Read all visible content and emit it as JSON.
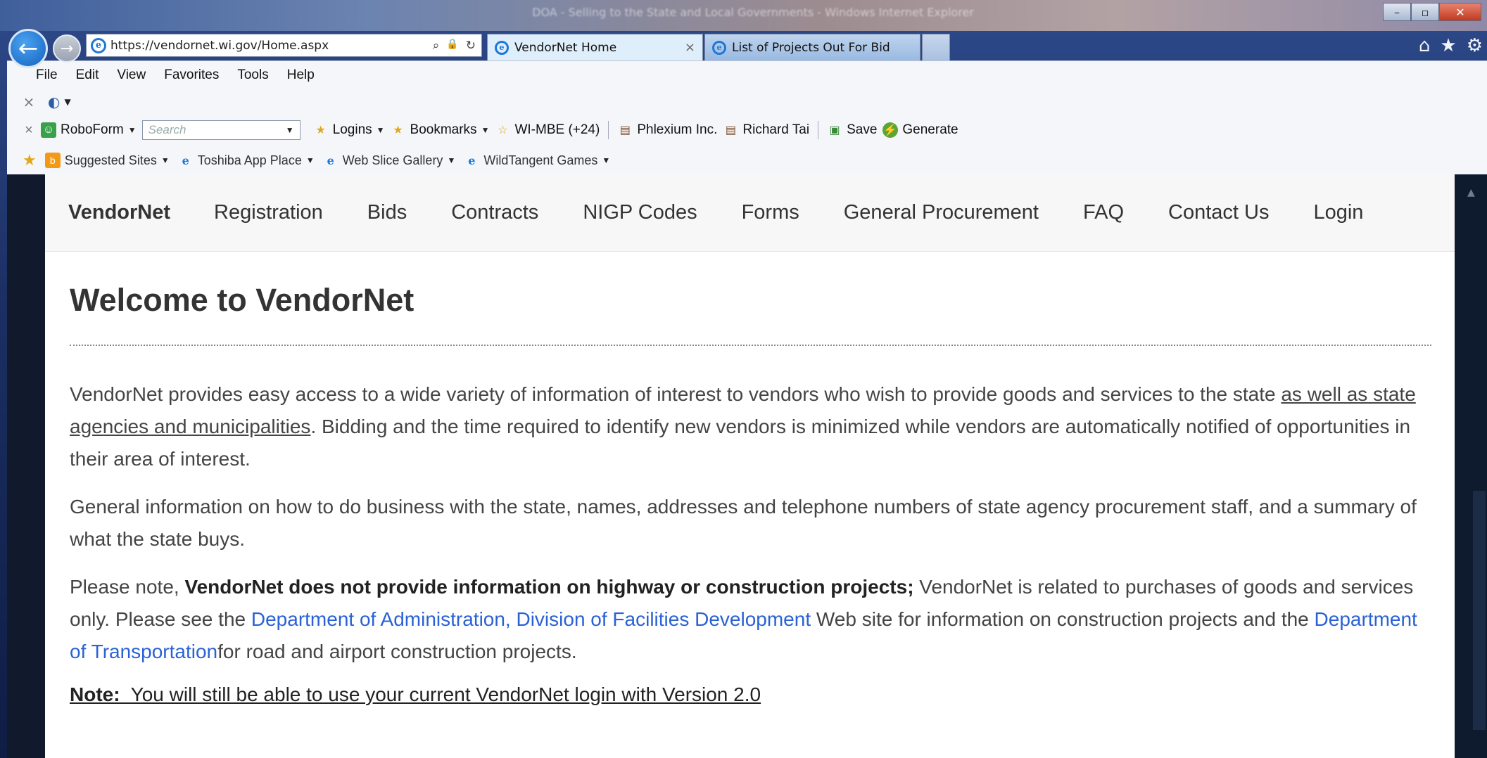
{
  "window": {
    "title": "DOA - Selling to the State and Local Governments - Windows Internet Explorer",
    "controls": {
      "minimize": "–",
      "maximize": "▫",
      "close": "✕"
    }
  },
  "navigation": {
    "back_icon": "←",
    "forward_icon": "→",
    "address": {
      "url": "https://vendornet.wi.gov/Home.aspx",
      "search_icon": "⌕",
      "lock_icon": "🔒",
      "refresh_icon": "↻"
    },
    "tabs": [
      {
        "label": "VendorNet Home",
        "close": "×"
      },
      {
        "label": "List of Projects Out For Bid"
      }
    ],
    "right_icons": {
      "home": "⌂",
      "favorites": "★",
      "tools": "⚙"
    }
  },
  "menubar": [
    "File",
    "Edit",
    "View",
    "Favorites",
    "Tools",
    "Help"
  ],
  "roboform": {
    "label": "RoboForm",
    "search_placeholder": "Search",
    "items": [
      {
        "label": "Logins"
      },
      {
        "label": "Bookmarks"
      },
      {
        "label": "WI-MBE (+24)"
      },
      {
        "label": "Phlexium Inc."
      },
      {
        "label": "Richard Tai"
      },
      {
        "label": "Save"
      },
      {
        "label": "Generate"
      }
    ]
  },
  "favorites_bar": [
    {
      "label": "Suggested Sites"
    },
    {
      "label": "Toshiba App Place"
    },
    {
      "label": "Web Slice Gallery"
    },
    {
      "label": "WildTangent Games"
    }
  ],
  "site": {
    "brand": "VendorNet",
    "nav": [
      "Registration",
      "Bids",
      "Contracts",
      "NIGP Codes",
      "Forms",
      "General Procurement",
      "FAQ",
      "Contact Us",
      "Login"
    ],
    "heading": "Welcome to VendorNet",
    "p1": {
      "a": "VendorNet provides easy access to a wide variety of information of interest to vendors who wish to provide goods and services to the state ",
      "u": "as well as state agencies and municipalities",
      "b": ". Bidding and the time required to identify new vendors is minimized while vendors are automatically notified of opportunities in their area of interest."
    },
    "p2": "General information on how to do business with the state, names, addresses and telephone numbers of state agency procurement staff, and a summary of what the state buys.",
    "p3": {
      "a": "Please note, ",
      "bold": "VendorNet does not provide information on highway or construction projects;",
      "b": " VendorNet is related to purchases of goods and services only. Please see the ",
      "link1": "Department of Administration, Division of Facilities Development",
      "c": " Web site for information on construction projects and the ",
      "link2": "Department of Transportation",
      "d": "for road and airport construction projects."
    },
    "note": {
      "label": "Note:",
      "text": "  You will still be able to use your current VendorNet login with Version 2.0"
    }
  }
}
